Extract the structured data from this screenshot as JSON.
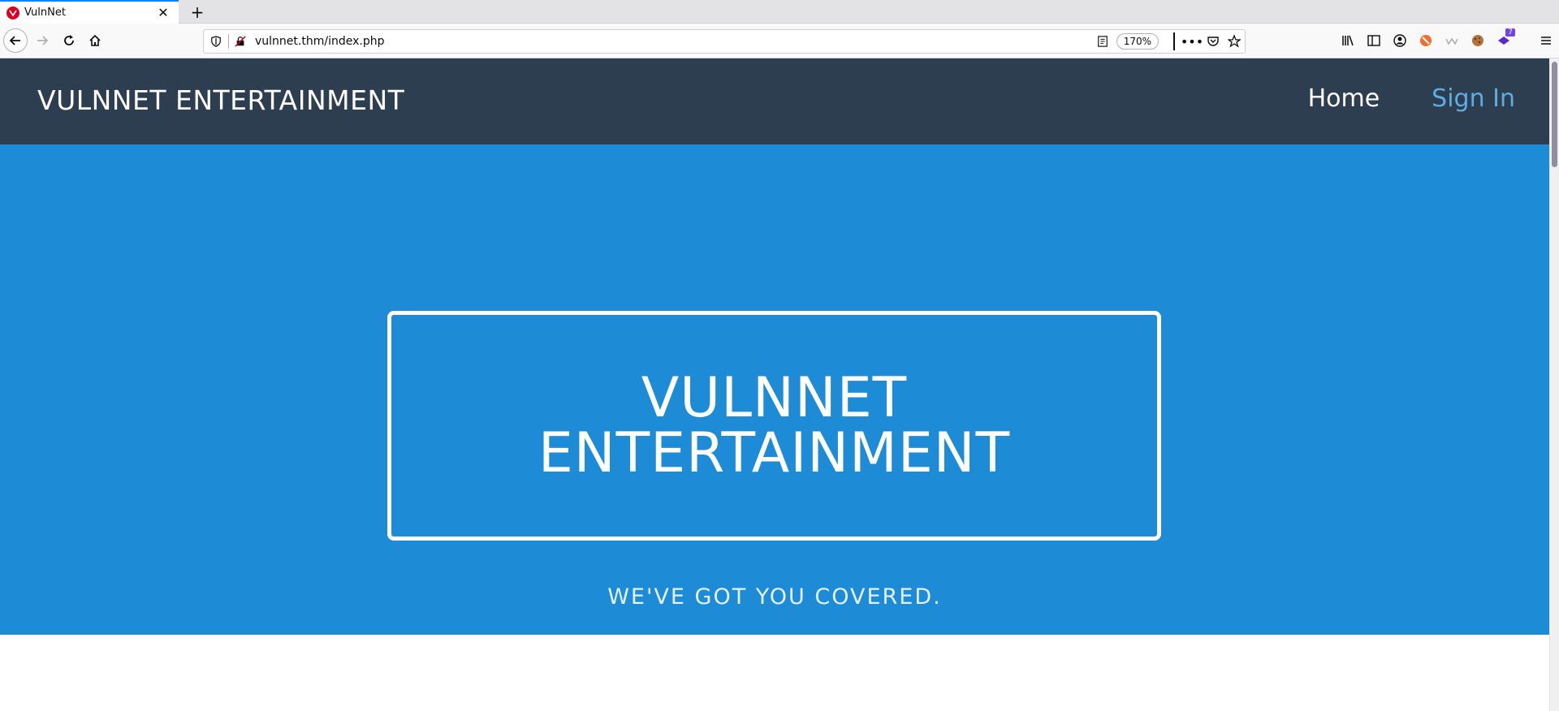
{
  "browser": {
    "tab": {
      "title": "VulnNet",
      "favicon": "vulnnet-favicon"
    },
    "url": "vulnnet.thm/index.php",
    "zoom": "170%",
    "extension_badge": "7"
  },
  "site": {
    "brand": "VULNNET ENTERTAINMENT",
    "nav": {
      "home": "Home",
      "sign_in": "Sign In"
    },
    "hero": {
      "title_line1": "VULNNET",
      "title_line2": "ENTERTAINMENT",
      "tagline": "WE'VE GOT YOU COVERED."
    }
  },
  "colors": {
    "header_bg": "#2c3e50",
    "hero_bg": "#1e8bd6",
    "sign_in_link": "#5dade2"
  }
}
